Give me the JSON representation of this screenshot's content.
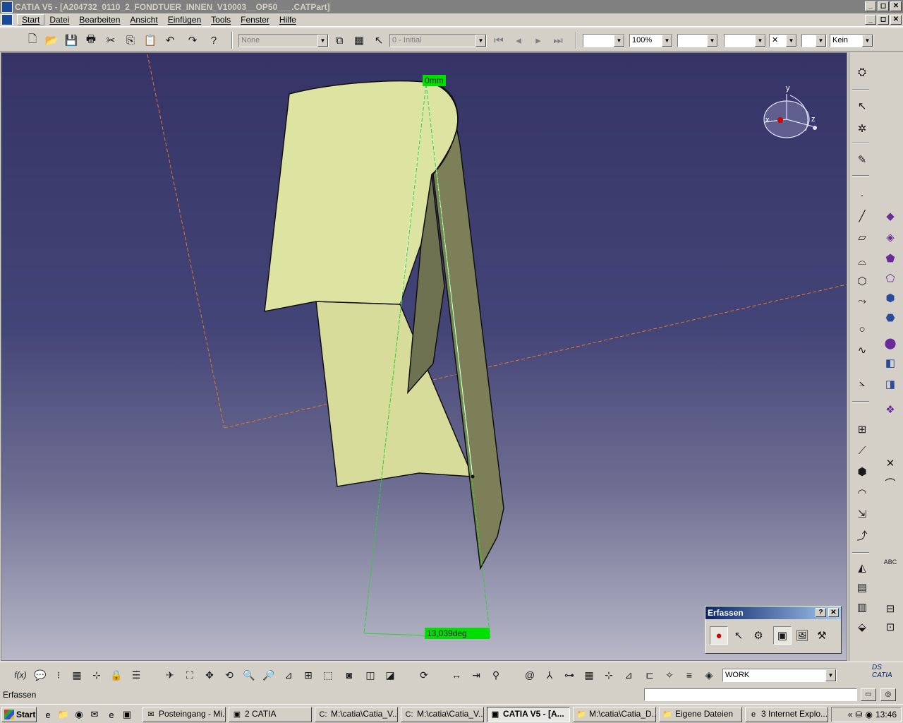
{
  "window": {
    "title": "CATIA V5 - [A204732_0110_2_FONDTUER_INNEN_V10003__OP50___.CATPart]",
    "controls": [
      "_",
      "◻",
      "✕"
    ],
    "doc_controls": [
      "_",
      "◻",
      "✕"
    ]
  },
  "menu": [
    "Start",
    "Datei",
    "Bearbeiten",
    "Ansicht",
    "Einfügen",
    "Tools",
    "Fenster",
    "Hilfe"
  ],
  "toolbar": {
    "layer_combo": "None",
    "snapshot_combo": "0 - Initial",
    "color_combo": "",
    "transparency_combo": "100%",
    "line_thickness_combo": "",
    "line_type_combo": "",
    "point_symbol_combo": "✕",
    "layer2_combo": "",
    "render_combo": "Kein"
  },
  "viewport": {
    "dim_length": "0mm",
    "dim_angle": "13,039deg",
    "compass": {
      "x": "x",
      "y": "y",
      "z": "z"
    }
  },
  "erfassen": {
    "title": "Erfassen",
    "help": "?",
    "close": "✕"
  },
  "bottom": {
    "workbench_combo": "WORK"
  },
  "status": {
    "text": "Erfassen"
  },
  "taskbar": {
    "start": "Start",
    "tasks": [
      {
        "label": "Posteingang - Mi...",
        "icon": "✉"
      },
      {
        "label": "2 CATIA",
        "icon": "▣"
      },
      {
        "label": "M:\\catia\\Catia_V...",
        "icon": "C:"
      },
      {
        "label": "M:\\catia\\Catia_V...",
        "icon": "C:"
      },
      {
        "label": "CATIA V5 - [A...",
        "icon": "▣"
      },
      {
        "label": "M:\\catia\\Catia_D...",
        "icon": "📁"
      },
      {
        "label": "Eigene Dateien",
        "icon": "📁"
      },
      {
        "label": "3 Internet Explo...",
        "icon": "e"
      }
    ],
    "clock": "13:46"
  }
}
